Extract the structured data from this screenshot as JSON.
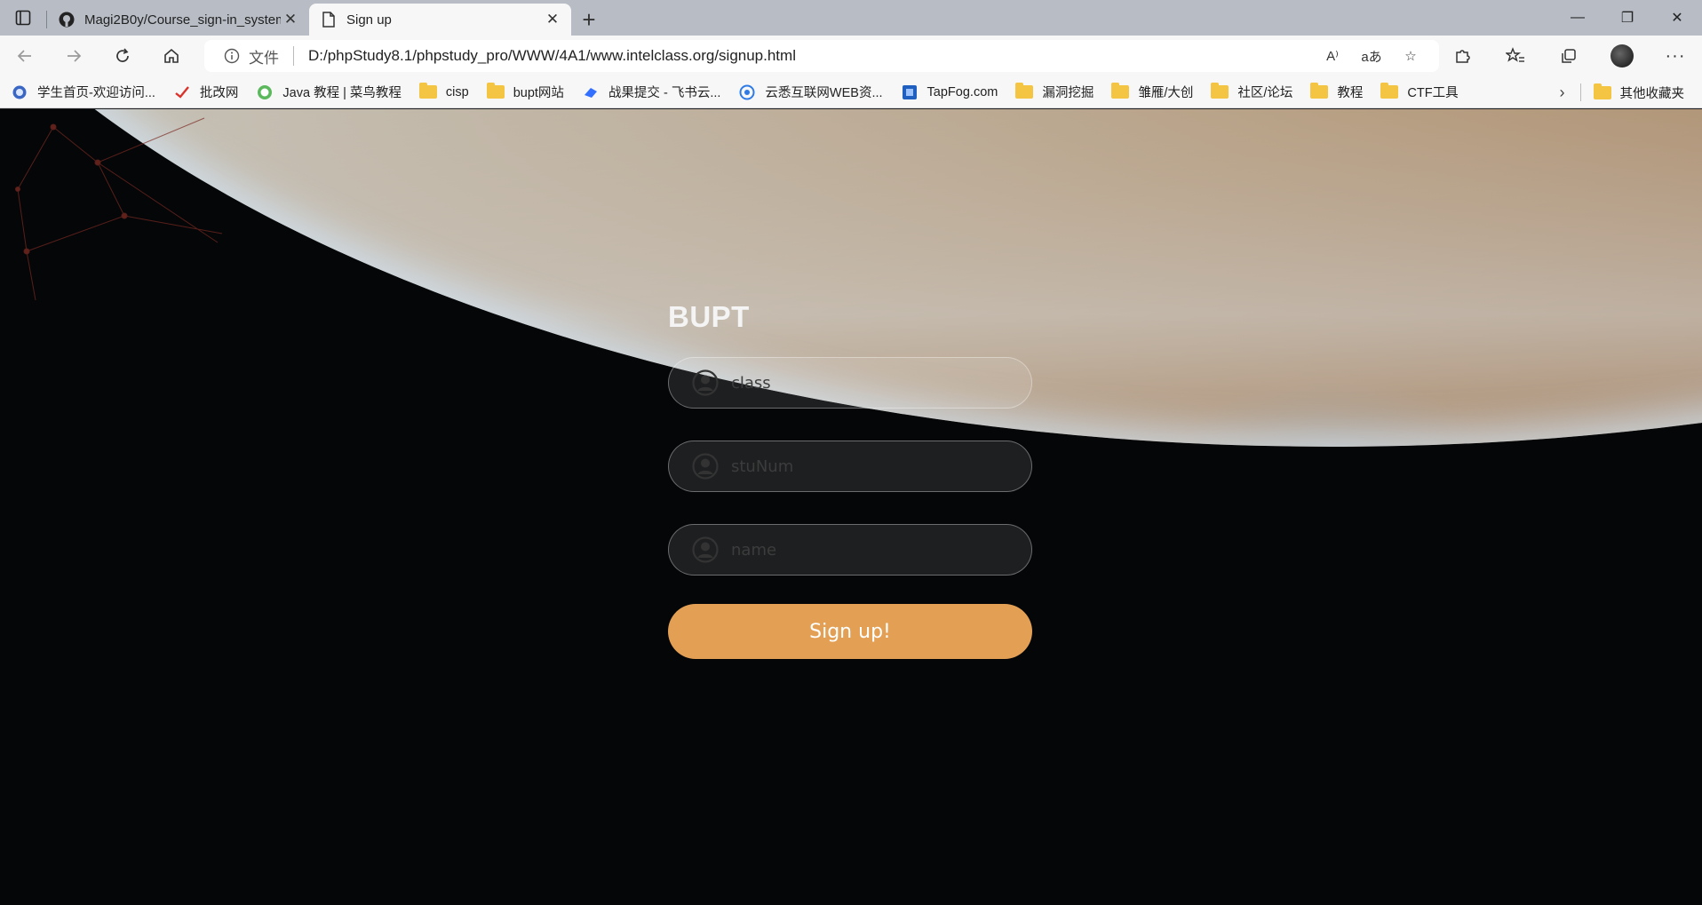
{
  "browser": {
    "tabs": [
      {
        "title": "Magi2B0y/Course_sign-in_system",
        "icon": "github-icon",
        "active": false
      },
      {
        "title": "Sign up",
        "icon": "page-icon",
        "active": true
      }
    ],
    "address": {
      "info_label": "文件",
      "url": "D:/phpStudy8.1/phpstudy_pro/WWW/4A1/www.intelclass.org/signup.html"
    },
    "bookmarks": [
      {
        "label": "学生首页-欢迎访问...",
        "icon": "globe-icon"
      },
      {
        "label": "批改网",
        "icon": "check-icon"
      },
      {
        "label": "Java 教程 | 菜鸟教程",
        "icon": "runoob-icon"
      },
      {
        "label": "cisp",
        "icon": "folder-icon"
      },
      {
        "label": "bupt网站",
        "icon": "folder-icon"
      },
      {
        "label": "战果提交 - 飞书云...",
        "icon": "feishu-icon"
      },
      {
        "label": "云悉互联网WEB资...",
        "icon": "yunxi-icon"
      },
      {
        "label": "TapFog.com",
        "icon": "tapfog-icon"
      },
      {
        "label": "漏洞挖掘",
        "icon": "folder-icon"
      },
      {
        "label": "雏雁/大创",
        "icon": "folder-icon"
      },
      {
        "label": "社区/论坛",
        "icon": "folder-icon"
      },
      {
        "label": "教程",
        "icon": "folder-icon"
      },
      {
        "label": "CTF工具",
        "icon": "folder-icon"
      }
    ],
    "other_bookmarks": "其他收藏夹"
  },
  "form": {
    "brand": "BUPT",
    "fields": [
      {
        "placeholder": "class",
        "value": ""
      },
      {
        "placeholder": "stuNum",
        "value": ""
      },
      {
        "placeholder": "name",
        "value": ""
      }
    ],
    "submit_label": "Sign up!"
  },
  "colors": {
    "button": "#e3a055",
    "chrome_tabbar": "#b7bcc5",
    "chrome_toolbar": "#f7f7f7"
  }
}
